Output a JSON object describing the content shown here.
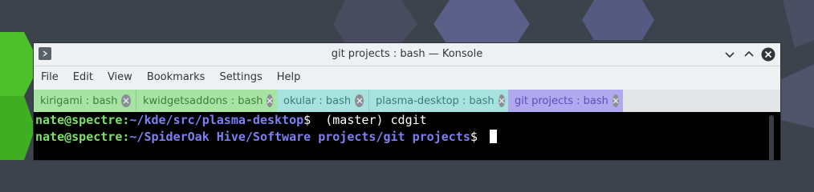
{
  "window": {
    "title": "git projects : bash — Konsole"
  },
  "menubar": {
    "items": [
      "File",
      "Edit",
      "View",
      "Bookmarks",
      "Settings",
      "Help"
    ]
  },
  "tabs": [
    {
      "label": "kirigami : bash",
      "color": "#a7e4a4",
      "active": false
    },
    {
      "label": "kwidgetsaddons : bash",
      "color": "#a7e4a4",
      "active": false
    },
    {
      "label": "okular : bash",
      "color": "#a8e2de",
      "active": false
    },
    {
      "label": "plasma-desktop : bash",
      "color": "#a8e2de",
      "active": false
    },
    {
      "label": "git projects : bash",
      "color": "#b0a9ef",
      "active": true
    }
  ],
  "terminal": {
    "lines": [
      {
        "user": "nate@spectre",
        "sep": ":",
        "path": "~/kde/src/plasma-desktop",
        "prompt": "$",
        "command": "  (master) cdgit"
      },
      {
        "user": "nate@spectre",
        "sep": ":",
        "path": "~/SpiderOak Hive/Software projects/git projects",
        "prompt": "$",
        "command": ""
      }
    ]
  },
  "colors": {
    "user": "#7ee16a",
    "path": "#7c80f2",
    "terminal_bg": "#000000"
  },
  "icons": [
    "window-menu-icon",
    "minimize-chevron-icon",
    "maximize-chevron-icon",
    "close-icon",
    "tab-close-icon"
  ]
}
